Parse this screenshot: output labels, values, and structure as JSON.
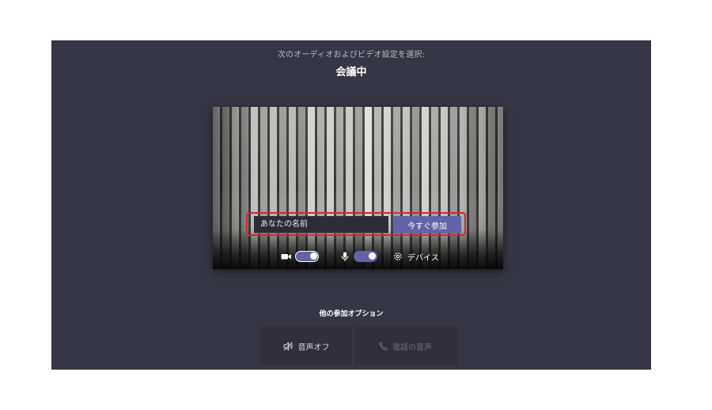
{
  "prejoin": {
    "heading": "次のオーディオおよびビデオ設定を選択:",
    "meeting_title": "会議中"
  },
  "join_form": {
    "name_placeholder": "あなたの名前",
    "name_value": "",
    "join_button_label": "今すぐ参加",
    "highlight_color": "#d0282f"
  },
  "controls": {
    "camera_icon": "video-camera-icon",
    "camera_on": true,
    "mic_icon": "microphone-icon",
    "mic_on": true,
    "devices_icon": "gear-icon",
    "devices_label": "デバイス"
  },
  "other_options": {
    "heading": "他の参加オプション",
    "audio_off_icon": "speaker-off-icon",
    "audio_off_label": "音声オフ",
    "phone_icon": "phone-icon",
    "phone_label": "電話の音声",
    "phone_disabled": true
  },
  "colors": {
    "background": "#373644",
    "accent": "#6264a7",
    "page": "#ffffff"
  }
}
